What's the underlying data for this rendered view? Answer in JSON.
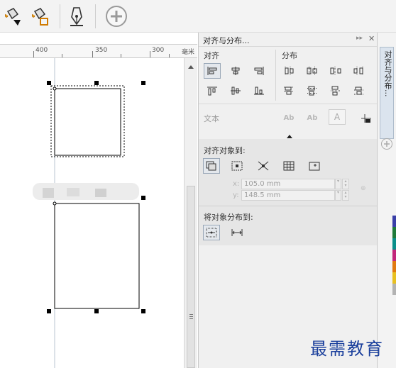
{
  "toolbar": {
    "icons": [
      "fill-icon",
      "outline-fill-icon",
      "pen-nib-icon",
      "add-circle-icon"
    ]
  },
  "ruler": {
    "labels": [
      "400",
      "350",
      "300"
    ],
    "unit": "毫米"
  },
  "panel": {
    "title": "对齐与分布...",
    "align_label": "对齐",
    "distribute_label": "分布",
    "text_label": "文本",
    "text_icon_labels": [
      "Ab",
      "Ab",
      "A"
    ],
    "align_to_label": "对齐对象到:",
    "x_label": "x:",
    "x_value": "105.0 mm",
    "y_label": "y:",
    "y_value": "148.5 mm",
    "distribute_to_label": "将对象分布到:"
  },
  "sidetab": {
    "label": "对齐与分布...",
    "swatch_colors": [
      "#3a3fa8",
      "#1f7a3a",
      "#0a8f8a",
      "#c2267a",
      "#e07a10",
      "#e8c020",
      "#b3b3b3"
    ]
  },
  "watermark": "最需教育"
}
